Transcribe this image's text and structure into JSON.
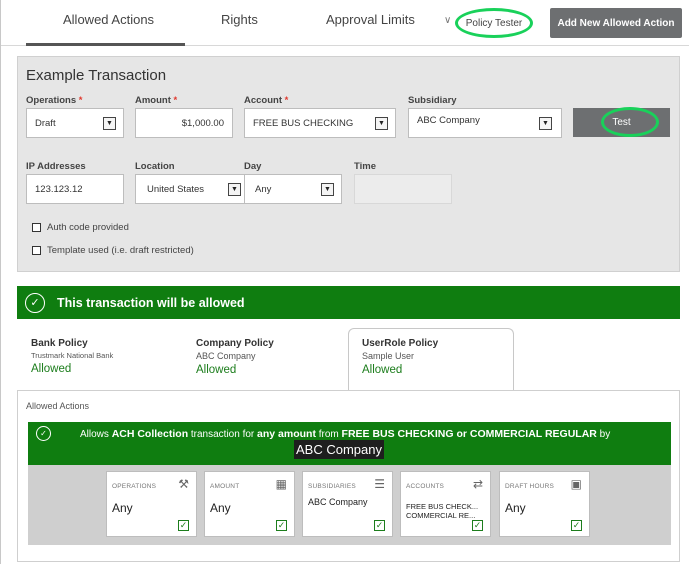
{
  "tabs": {
    "allowed_actions": "Allowed Actions",
    "rights": "Rights",
    "approval_limits": "Approval Limits",
    "policy_tester": "Policy Tester",
    "add_new": "Add New Allowed Action"
  },
  "transaction": {
    "title": "Example Transaction",
    "operations_label": "Operations",
    "operations_value": "Draft",
    "amount_label": "Amount",
    "amount_value": "$1,000.00",
    "account_label": "Account",
    "account_value": "FREE BUS CHECKING",
    "subsidiary_label": "Subsidiary",
    "subsidiary_value": "ABC Company",
    "test_button": "Test",
    "ip_label": "IP Addresses",
    "ip_value": "123.123.12",
    "location_label": "Location",
    "location_value": "United States",
    "day_label": "Day",
    "day_value": "Any",
    "time_label": "Time",
    "auth_code": "Auth code provided",
    "template_used": "Template used (i.e. draft restricted)",
    "required_mark": "*"
  },
  "result": {
    "banner": "This transaction will be allowed"
  },
  "policies": [
    {
      "title": "Bank Policy",
      "sub": "Trustmark National Bank",
      "status": "Allowed"
    },
    {
      "title": "Company Policy",
      "sub": "ABC Company",
      "status": "Allowed"
    },
    {
      "title": "UserRole Policy",
      "sub": "Sample User",
      "status": "Allowed"
    }
  ],
  "allowed_actions": {
    "label": "Allowed Actions",
    "sentence": {
      "pre": "Allows",
      "type": "ACH Collection",
      "mid1": "transaction for",
      "amount": "any amount",
      "mid2": "from",
      "accounts": "FREE BUS CHECKING or COMMERCIAL REGULAR",
      "post": "by"
    },
    "company": "ABC Company",
    "cards": [
      {
        "title": "OPERATIONS",
        "value": "Any"
      },
      {
        "title": "AMOUNT",
        "value": "Any"
      },
      {
        "title": "SUBSIDIARIES",
        "value": "ABC Company"
      },
      {
        "title": "ACCOUNTS",
        "value1": "FREE BUS CHECK...",
        "value2": "COMMERCIAL RE..."
      },
      {
        "title": "DRAFT HOURS",
        "value": "Any"
      }
    ]
  },
  "colors": {
    "success_green": "#0f7d10",
    "highlight_ring": "#19d15a",
    "button_grey": "#6d6f71"
  }
}
